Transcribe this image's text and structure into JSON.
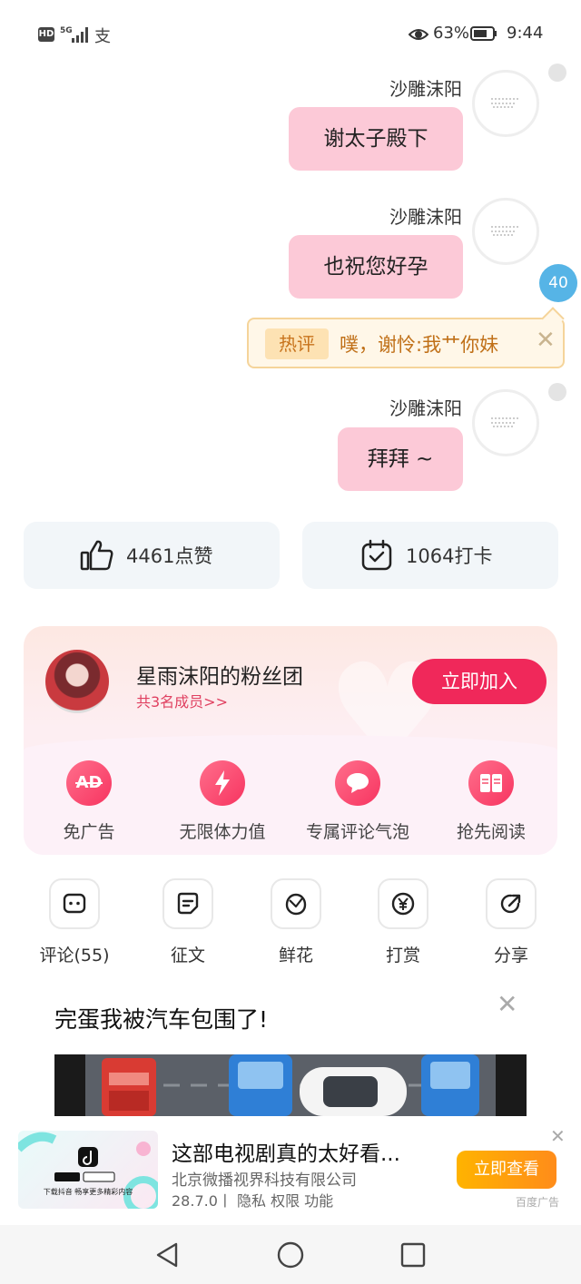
{
  "status_bar": {
    "hd_label": "HD",
    "network_label": "5G",
    "battery_percent": "63%",
    "time": "9:44",
    "pay_icon_glyph": "支"
  },
  "chat": {
    "messages": [
      {
        "sender": "沙雕沫阳",
        "text": "谢太子殿下"
      },
      {
        "sender": "沙雕沫阳",
        "text": "也祝您好孕"
      },
      {
        "sender": "沙雕沫阳",
        "text": "拜拜 ~"
      }
    ],
    "comment_count": "40",
    "hot_comment": {
      "tag": "热评",
      "text": "噗，谢怜:我艹你妹",
      "close": "✕"
    }
  },
  "stats": {
    "likes": "4461点赞",
    "checkins": "1064打卡"
  },
  "fan_club": {
    "title": "星雨沫阳的粉丝团",
    "subtitle": "共3名成员>>",
    "join_label": "立即加入",
    "perks": [
      {
        "label": "免广告",
        "icon": "ad-free-icon"
      },
      {
        "label": "无限体力值",
        "icon": "lightning-icon"
      },
      {
        "label": "专属评论气泡",
        "icon": "comment-bubble-icon"
      },
      {
        "label": "抢先阅读",
        "icon": "book-icon"
      }
    ],
    "ad_icon_text": "AD"
  },
  "actions": [
    {
      "label": "评论(55)",
      "icon": "comment-icon"
    },
    {
      "label": "征文",
      "icon": "essay-icon"
    },
    {
      "label": "鲜花",
      "icon": "flower-icon"
    },
    {
      "label": "打赏",
      "icon": "yen-icon"
    },
    {
      "label": "分享",
      "icon": "share-icon"
    }
  ],
  "ad1": {
    "title": "完蛋我被汽车包围了!",
    "close": "✕"
  },
  "ad2": {
    "title": "这部电视剧真的太好看...",
    "company": "北京微播视界科技有限公司",
    "meta": "28.7.0丨 隐私  权限  功能",
    "button": "立即查看",
    "source": "百度广告",
    "close": "✕",
    "image_caption": "下载抖音 畅享更多精彩内容"
  },
  "colors": {
    "bubble": "#fcc9d7",
    "join_button": "#f0285a",
    "badge": "#56b4e6",
    "cta": "#ff9a10"
  }
}
